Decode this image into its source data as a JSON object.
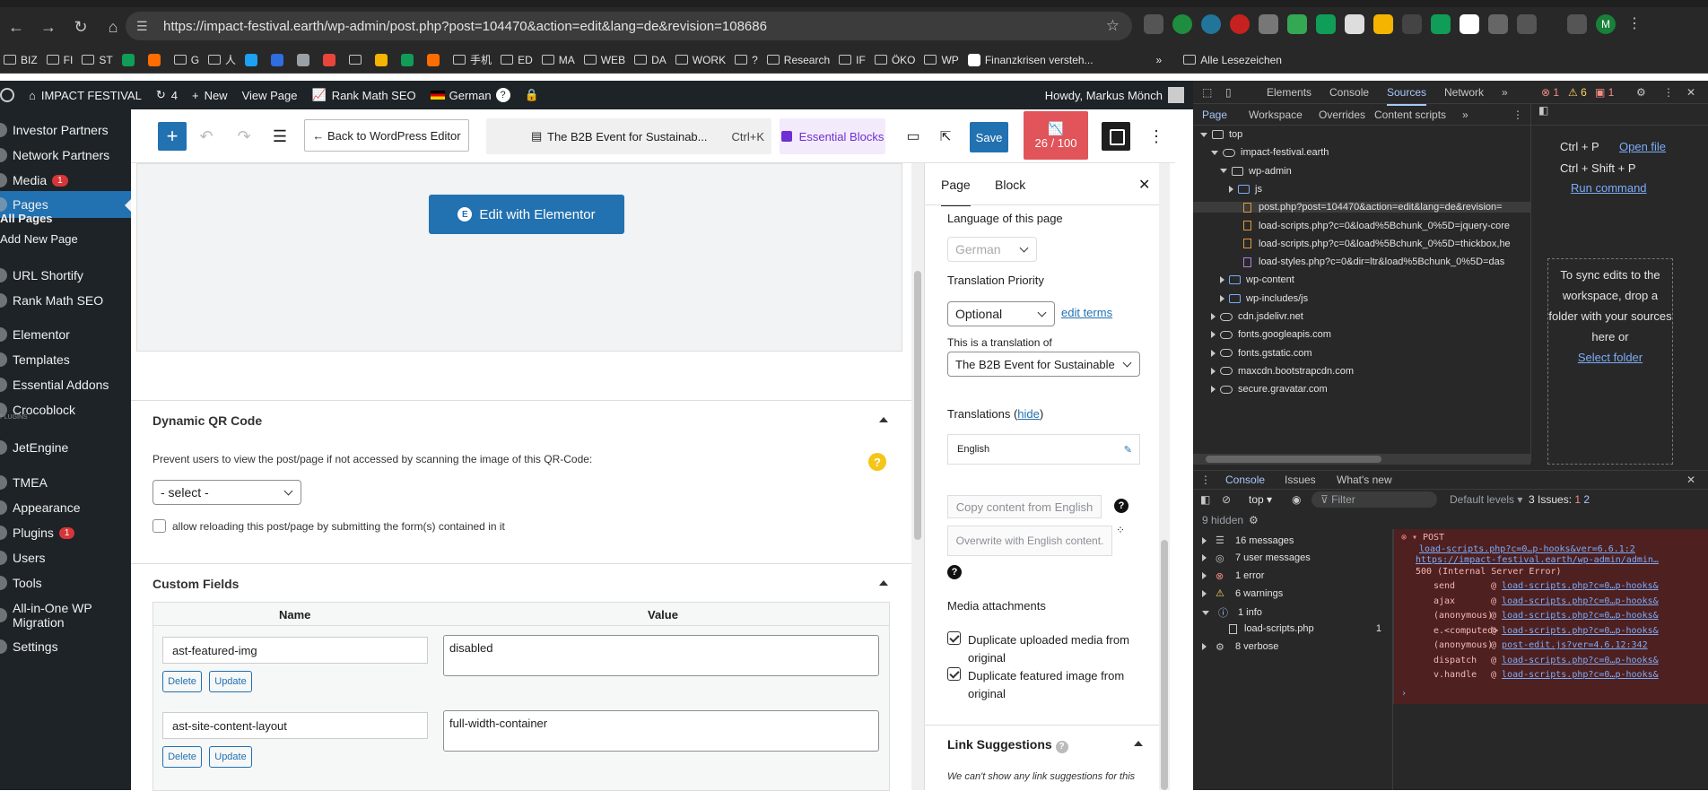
{
  "browser": {
    "url": "https://impact-festival.earth/wp-admin/post.php?post=104470&action=edit&lang=de&revision=108686",
    "profile": "M"
  },
  "bookmarks": [
    {
      "label": "BIZ",
      "icon": "folder"
    },
    {
      "label": "FI",
      "icon": "folder"
    },
    {
      "label": "ST",
      "icon": "folder"
    },
    {
      "label": "",
      "icon": "app"
    },
    {
      "label": "",
      "icon": "app"
    },
    {
      "label": "G",
      "icon": "folder"
    },
    {
      "label": "人",
      "icon": "folder"
    },
    {
      "label": "",
      "icon": "app"
    },
    {
      "label": "",
      "icon": "app"
    },
    {
      "label": "",
      "icon": "app"
    },
    {
      "label": "",
      "icon": "app"
    },
    {
      "label": "",
      "icon": "folder"
    },
    {
      "label": "",
      "icon": "app"
    },
    {
      "label": "",
      "icon": "app"
    },
    {
      "label": "",
      "icon": "app"
    },
    {
      "label": "手机",
      "icon": "folder"
    },
    {
      "label": "ED",
      "icon": "folder"
    },
    {
      "label": "MA",
      "icon": "folder"
    },
    {
      "label": "WEB",
      "icon": "folder"
    },
    {
      "label": "DA",
      "icon": "folder"
    },
    {
      "label": "WORK",
      "icon": "folder"
    },
    {
      "label": "?",
      "icon": "folder"
    },
    {
      "label": "Research",
      "icon": "folder"
    },
    {
      "label": "IF",
      "icon": "folder"
    },
    {
      "label": "ÖKO",
      "icon": "folder"
    },
    {
      "label": "WP",
      "icon": "folder"
    },
    {
      "label": "Finanzkrisen versteh...",
      "icon": "app"
    },
    {
      "label": "»",
      "icon": "none"
    },
    {
      "label": "Alle Lesezeichen",
      "icon": "folder"
    }
  ],
  "adminbar": {
    "site": "IMPACT FESTIVAL",
    "updates": "4",
    "new": "New",
    "view": "View Page",
    "rankmath": "Rank Math SEO",
    "lang": "German",
    "howdy": "Howdy, Markus Mönch"
  },
  "wpmenu": [
    {
      "label": "Investor Partners"
    },
    {
      "label": "Network Partners"
    },
    {
      "label": "Media",
      "badge": "1"
    },
    {
      "label": "Pages",
      "current": true
    },
    {
      "label": "URL Shortify"
    },
    {
      "label": "Rank Math SEO"
    },
    {
      "label": "Elementor"
    },
    {
      "label": "Templates"
    },
    {
      "label": "Essential Addons"
    },
    {
      "label": "Crocoblock"
    },
    {
      "label": "JetEngine"
    },
    {
      "label": "TMEA"
    },
    {
      "label": "Appearance"
    },
    {
      "label": "Plugins",
      "badge": "1"
    },
    {
      "label": "Users"
    },
    {
      "label": "Tools"
    },
    {
      "label": "All-in-One WP Migration"
    },
    {
      "label": "Settings"
    }
  ],
  "wpsub": {
    "all": "All Pages",
    "add": "Add New Page",
    "plugins_sep": "PLUGINS"
  },
  "toolbar": {
    "back": "← Back to WordPress Editor",
    "doc_title": "The B2B Event for Sustainab...",
    "shortcut": "Ctrl+K",
    "essential": "Essential Blocks",
    "save": "Save",
    "score": "26 / 100"
  },
  "canvas": {
    "elementor_btn": "Edit with Elementor"
  },
  "qr": {
    "title": "Dynamic QR Code",
    "desc": "Prevent users to view the post/page if not accessed by scanning the image of this QR-Code:",
    "select": "- select -",
    "checkbox": "allow reloading this post/page by submitting the form(s) contained in it"
  },
  "customfields": {
    "title": "Custom Fields",
    "col_name": "Name",
    "col_value": "Value",
    "rows": [
      {
        "name": "ast-featured-img",
        "value": "disabled"
      },
      {
        "name": "ast-site-content-layout",
        "value": "full-width-container"
      }
    ],
    "delete": "Delete",
    "update": "Update"
  },
  "sidebar": {
    "tab_page": "Page",
    "tab_block": "Block",
    "lang_label": "Language of this page",
    "lang_value": "German",
    "priority_label": "Translation Priority",
    "priority_value": "Optional",
    "edit_terms": "edit terms",
    "translation_of": "This is a translation of",
    "translation_of_value": "The B2B Event for Sustainable",
    "translations": "Translations",
    "hide": "hide",
    "english": "English",
    "copy_btn": "Copy content from English",
    "overwrite_btn": "Overwrite with English content.",
    "media_title": "Media attachments",
    "dup_media": "Duplicate uploaded media from original",
    "dup_featured": "Duplicate featured image from original",
    "link_sugg": "Link Suggestions",
    "link_note": "We can't show any link suggestions for this"
  },
  "devtools": {
    "tabs": [
      "Elements",
      "Console",
      "Sources",
      "Network"
    ],
    "counts": {
      "errors": "1",
      "warnings": "6",
      "issues": "1"
    },
    "subtabs": [
      "Page",
      "Workspace",
      "Overrides",
      "Content scripts"
    ],
    "tree": [
      {
        "label": "top",
        "type": "top",
        "depth": 0
      },
      {
        "label": "impact-festival.earth",
        "type": "cloud",
        "depth": 1
      },
      {
        "label": "wp-admin",
        "type": "folder",
        "depth": 2
      },
      {
        "label": "js",
        "type": "folder",
        "depth": 3
      },
      {
        "label": "post.php?post=104470&action=edit&lang=de&revision=",
        "type": "file",
        "depth": 4
      },
      {
        "label": "load-scripts.php?c=0&load%5Bchunk_0%5D=jquery-core",
        "type": "file",
        "depth": 4
      },
      {
        "label": "load-scripts.php?c=0&load%5Bchunk_0%5D=thickbox,he",
        "type": "file",
        "depth": 4
      },
      {
        "label": "load-styles.php?c=0&dir=ltr&load%5Bchunk_0%5D=das",
        "type": "filep",
        "depth": 4
      },
      {
        "label": "wp-content",
        "type": "folder",
        "depth": 2
      },
      {
        "label": "wp-includes/js",
        "type": "folder",
        "depth": 2
      },
      {
        "label": "cdn.jsdelivr.net",
        "type": "cloud",
        "depth": 1
      },
      {
        "label": "fonts.googleapis.com",
        "type": "cloud",
        "depth": 1
      },
      {
        "label": "fonts.gstatic.com",
        "type": "cloud",
        "depth": 1
      },
      {
        "label": "maxcdn.bootstrapcdn.com",
        "type": "cloud",
        "depth": 1
      },
      {
        "label": "secure.gravatar.com",
        "type": "cloud",
        "depth": 1
      }
    ],
    "nav": {
      "open_key": "Ctrl + P",
      "open": "Open file",
      "run_key": "Ctrl + Shift + P",
      "run": "Run command",
      "drop": "To sync edits to the workspace, drop a folder with your sources here or",
      "select": "Select folder"
    },
    "console": {
      "tabs": [
        "Console",
        "Issues",
        "What's new"
      ],
      "context": "top",
      "filter": "Filter",
      "levels": "Default levels",
      "issues": "3 Issues:",
      "issue_err": "1",
      "issue_info": "2",
      "hidden": "9 hidden",
      "groups": [
        {
          "label": "16 messages",
          "icon": "list"
        },
        {
          "label": "7 user messages",
          "icon": "user"
        },
        {
          "label": "1 error",
          "icon": "error"
        },
        {
          "label": "6 warnings",
          "icon": "warning"
        },
        {
          "label": "1 info",
          "icon": "info"
        },
        {
          "label": "load-scripts.php",
          "count": "1"
        },
        {
          "label": "8 verbose",
          "icon": "verbose"
        }
      ],
      "error": {
        "method": "POST",
        "url1": "load-scripts.php?c=0…p-hooks&ver=6.6.1:2",
        "url2": "https://impact-festival.earth/wp-admin/admin…",
        "status": "500 (Internal Server Error)",
        "stack": [
          {
            "fn": "send",
            "loc": "load-scripts.php?c=0…p-hooks&"
          },
          {
            "fn": "ajax",
            "loc": "load-scripts.php?c=0…p-hooks&"
          },
          {
            "fn": "(anonymous)",
            "loc": "load-scripts.php?c=0…p-hooks&"
          },
          {
            "fn": "e.<computed>",
            "loc": "load-scripts.php?c=0…p-hooks&"
          },
          {
            "fn": "(anonymous)",
            "loc": "post-edit.js?ver=4.6.12:342"
          },
          {
            "fn": "dispatch",
            "loc": "load-scripts.php?c=0…p-hooks&"
          },
          {
            "fn": "v.handle",
            "loc": "load-scripts.php?c=0…p-hooks&"
          }
        ]
      }
    }
  }
}
